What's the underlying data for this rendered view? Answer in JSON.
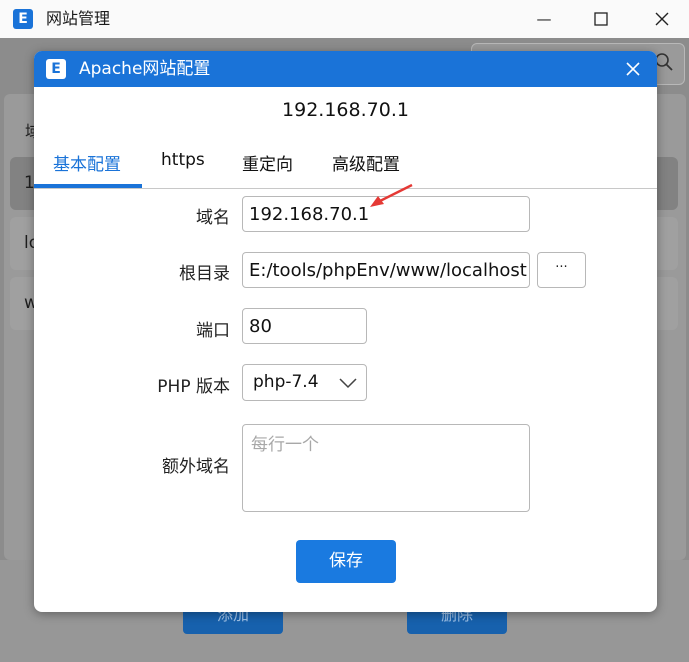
{
  "background_window": {
    "title": "网站管理",
    "column_label_fragment": "域",
    "rows": [
      "1",
      "lo",
      "w"
    ],
    "buttons": {
      "add": "添加",
      "delete": "删除"
    }
  },
  "dialog": {
    "title": "Apache网站配置",
    "host": "192.168.70.1",
    "tabs": [
      "基本配置",
      "https",
      "重定向",
      "高级配置"
    ],
    "active_tab": "基本配置",
    "fields": {
      "domain_label": "域名",
      "domain_value": "192.168.70.1",
      "root_label": "根目录",
      "root_value": "E:/tools/phpEnv/www/localhost",
      "browse_label": "···",
      "port_label": "端口",
      "port_value": "80",
      "php_label": "PHP 版本",
      "php_value": "php-7.4",
      "extra_label": "额外域名",
      "extra_placeholder": "每行一个"
    },
    "save_label": "保存"
  },
  "icons": {
    "app": "app-logo-icon",
    "search": "search-icon",
    "close": "close-icon",
    "chevron": "chevron-down-icon"
  },
  "colors": {
    "accent": "#1a73d8",
    "button": "#1a7ae0",
    "annotation_arrow": "#e53935"
  }
}
